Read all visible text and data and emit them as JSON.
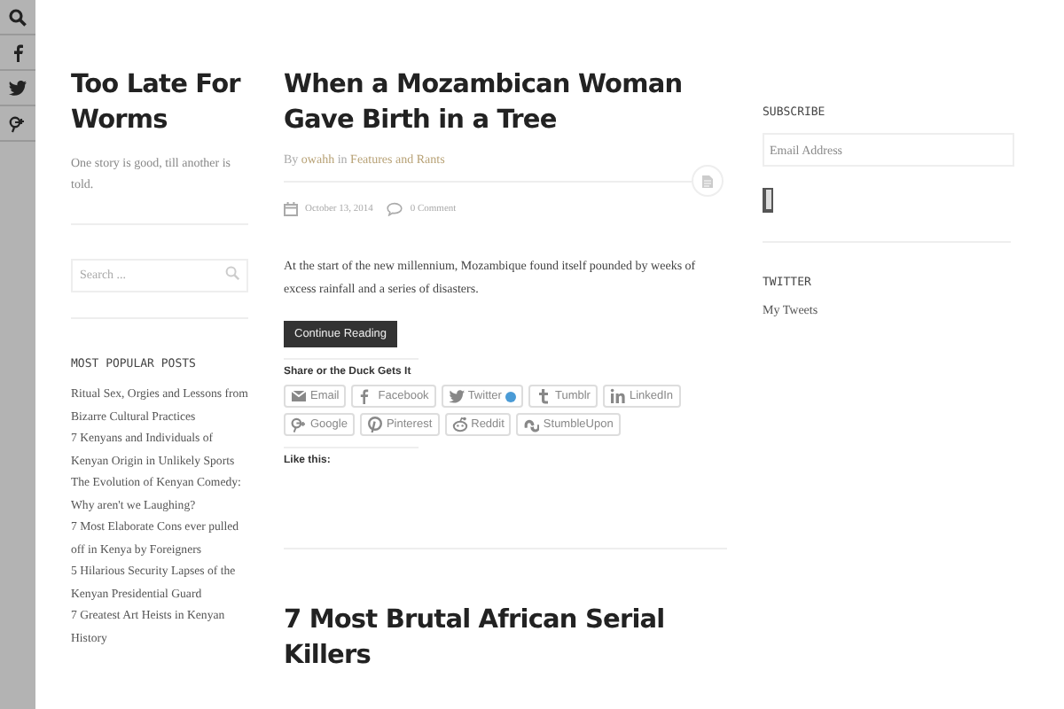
{
  "social_bar": [
    {
      "kind": "search"
    },
    {
      "kind": "facebook"
    },
    {
      "kind": "twitter"
    },
    {
      "kind": "googleplus"
    }
  ],
  "site": {
    "title": "Too Late For Worms",
    "tagline": "One story is good, till another is told."
  },
  "search": {
    "placeholder": "Search ..."
  },
  "popular_posts": {
    "heading": "MOST POPULAR POSTS",
    "items": [
      "Ritual Sex, Orgies and Lessons from Bizarre Cultural Practices",
      "7 Kenyans and Individuals of Kenyan Origin in Unlikely Sports",
      "The Evolution of Kenyan Comedy: Why aren't we Laughing?",
      "7 Most Elaborate Cons ever pulled off in Kenya by Foreigners",
      "5 Hilarious Security Lapses of the Kenyan Presidential Guard",
      "7 Greatest Art Heists in Kenyan History"
    ]
  },
  "posts": [
    {
      "title": "When a Mozambican Woman Gave Birth in a Tree",
      "by": "By",
      "author": "owahh",
      "in": "in",
      "category": "Features and Rants",
      "date": "October 13, 2014",
      "comments": "0 Comment",
      "excerpt": "At the start of the new millennium, Mozambique found itself pounded by weeks of excess rainfall and a series of disasters.",
      "button": "Continue Reading",
      "share_heading": "Share or the Duck Gets It",
      "share": [
        {
          "kind": "email",
          "label": "Email"
        },
        {
          "kind": "facebook",
          "label": "Facebook"
        },
        {
          "kind": "twitter",
          "label": "Twitter"
        },
        {
          "kind": "tumblr",
          "label": "Tumblr"
        },
        {
          "kind": "linkedin",
          "label": "LinkedIn"
        },
        {
          "kind": "google",
          "label": "Google"
        },
        {
          "kind": "pinterest",
          "label": "Pinterest"
        },
        {
          "kind": "reddit",
          "label": "Reddit"
        },
        {
          "kind": "stumbleupon",
          "label": "StumbleUpon"
        }
      ],
      "like_heading": "Like this:"
    },
    {
      "title": "7 Most Brutal African Serial Killers"
    }
  ],
  "subscribe": {
    "heading": "SUBSCRIBE",
    "placeholder": "Email Address"
  },
  "twitter": {
    "heading": "TWITTER",
    "link": "My Tweets"
  }
}
